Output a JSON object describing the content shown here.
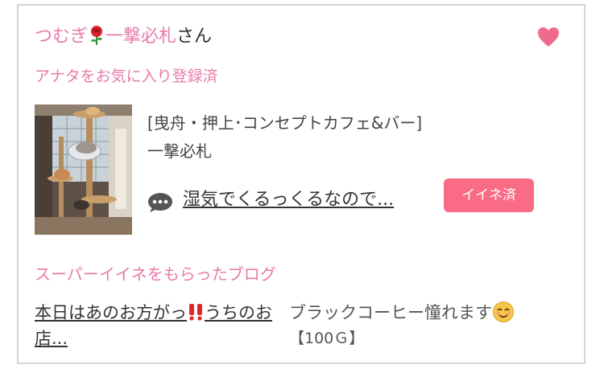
{
  "user": {
    "name": "つむぎ",
    "name_rest": "一撃必札",
    "suffix": "さん"
  },
  "favorite_status": "アナタをお気に入り登録済",
  "shop": {
    "location_and_type": "[曳舟・押上･コンセプトカフェ&バー]",
    "name": "一撃必札"
  },
  "blog": {
    "title": "湿気でくるっくるなので...",
    "like_label": "イイネ済"
  },
  "super_like": {
    "heading": "スーパーイイネをもらったブログ",
    "blog_title_part1": "本日はあのお方がっ",
    "blog_title_part2": "うちのお店...",
    "message": "ブラックコーヒー憧れます",
    "points": "【100Ｇ】"
  },
  "colors": {
    "accent_pink": "#e87aa9",
    "button_pink": "#fa6b86",
    "heart": "#f06a8e"
  },
  "icons": [
    "rose-icon",
    "heart-icon",
    "comment-icon",
    "double-exclamation-icon",
    "smiling-face-icon"
  ]
}
